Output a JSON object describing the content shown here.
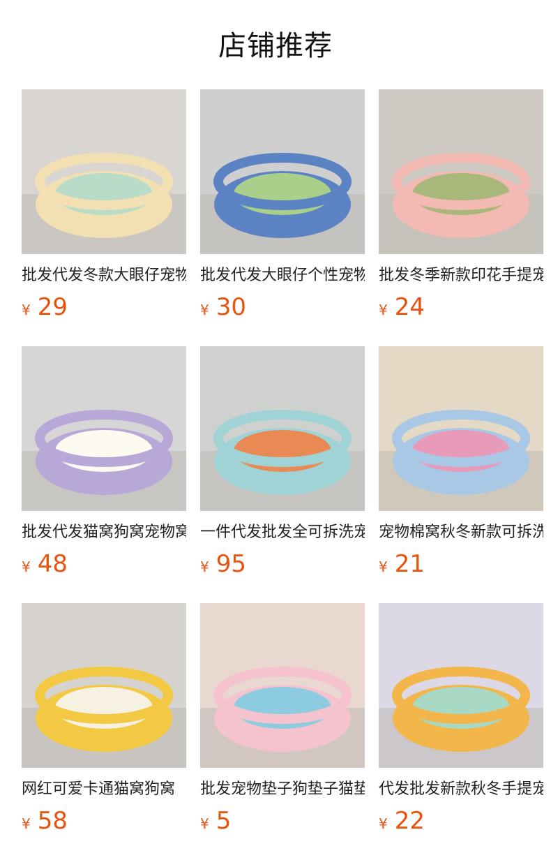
{
  "page": {
    "title": "店铺推荐"
  },
  "products": [
    {
      "name": "批发代发冬款大眼仔宠物窝",
      "currency": "¥",
      "price": "29",
      "image_icon": "pet-bed-photo",
      "colors": {
        "bg": "#d9d6d2",
        "bed": "#f2dfb2",
        "accent": "#b9dcc9"
      }
    },
    {
      "name": "批发代发大眼仔个性宠物窝",
      "currency": "¥",
      "price": "30",
      "image_icon": "pet-bed-photo",
      "colors": {
        "bg": "#cfcfcf",
        "bed": "#5b83c4",
        "accent": "#a9cf8a"
      }
    },
    {
      "name": "批发冬季新款印花手提宠物窝",
      "currency": "¥",
      "price": "24",
      "image_icon": "pet-bed-photo",
      "colors": {
        "bg": "#cfc9c3",
        "bed": "#f3b9b3",
        "accent": "#a8b77a"
      }
    },
    {
      "name": "批发代发猫窝狗窝宠物窝",
      "currency": "¥",
      "price": "48",
      "image_icon": "pet-bed-photo",
      "colors": {
        "bg": "#d6d6d6",
        "bed": "#b8a8d8",
        "accent": "#fdfaf0"
      }
    },
    {
      "name": "一件代发批发全可拆洗宠物窝",
      "currency": "¥",
      "price": "95",
      "image_icon": "pet-bed-photo",
      "colors": {
        "bg": "#cfd1cf",
        "bed": "#9fd3d6",
        "accent": "#e98a55"
      }
    },
    {
      "name": "宠物棉窝秋冬新款可拆洗",
      "currency": "¥",
      "price": "21",
      "image_icon": "pet-bed-photo",
      "colors": {
        "bg": "#e4d9c4",
        "bed": "#a8c8e6",
        "accent": "#e89bb8"
      }
    },
    {
      "name": "网红可爱卡通猫窝狗窝",
      "currency": "¥",
      "price": "58",
      "image_icon": "pet-bed-photo",
      "colors": {
        "bg": "#d6d3cf",
        "bed": "#f3c842",
        "accent": "#f6f1e1"
      }
    },
    {
      "name": "批发宠物垫子狗垫子猫垫",
      "currency": "¥",
      "price": "5",
      "image_icon": "pet-bed-photo",
      "colors": {
        "bg": "#e8d8cf",
        "bed": "#f5c3cd",
        "accent": "#8ccbe0"
      }
    },
    {
      "name": "代发批发新款秋冬手提宠物窝",
      "currency": "¥",
      "price": "22",
      "image_icon": "pet-bed-photo",
      "colors": {
        "bg": "#dcd8e6",
        "bed": "#f2b64a",
        "accent": "#a7d9c5"
      }
    }
  ]
}
